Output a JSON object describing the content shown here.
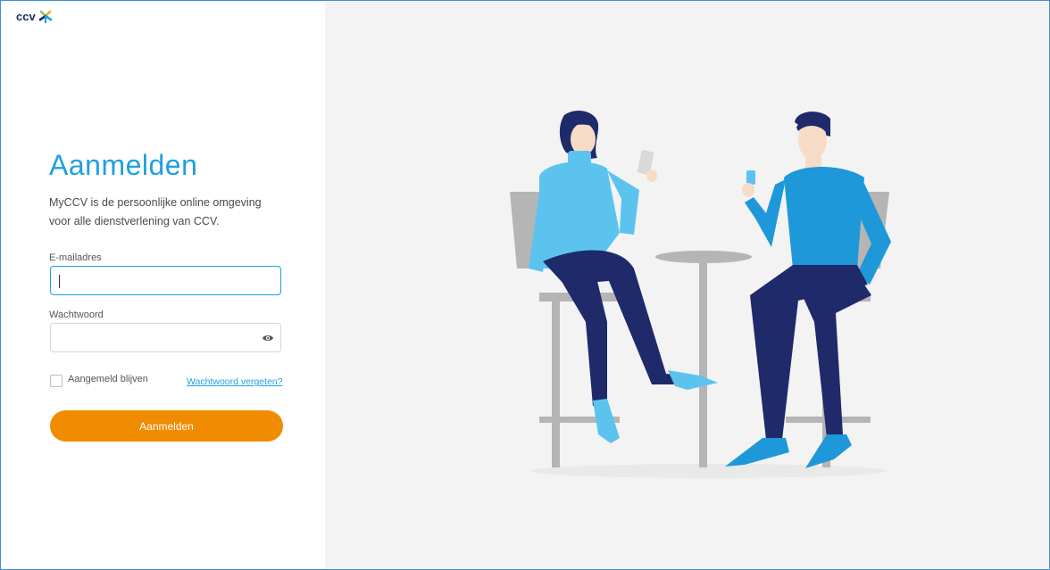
{
  "brand": {
    "logo_text": "ccv"
  },
  "login": {
    "title": "Aanmelden",
    "intro": "MyCCV is de persoonlijke online omgeving voor alle dienstverlening van CCV.",
    "email_label": "E-mailadres",
    "email_value": "",
    "password_label": "Wachtwoord",
    "password_value": "",
    "remember_label": "Aangemeld blijven",
    "forgot_link": "Wachtwoord vergeten?",
    "submit_label": "Aanmelden"
  },
  "icons": {
    "logo": "ccv-star-logo-icon",
    "password_toggle": "eye-icon"
  },
  "colors": {
    "accent_blue": "#1ea0e0",
    "button_orange": "#f08c00",
    "brand_navy": "#1b2a6b",
    "illustration_bg": "#f3f3f3"
  }
}
